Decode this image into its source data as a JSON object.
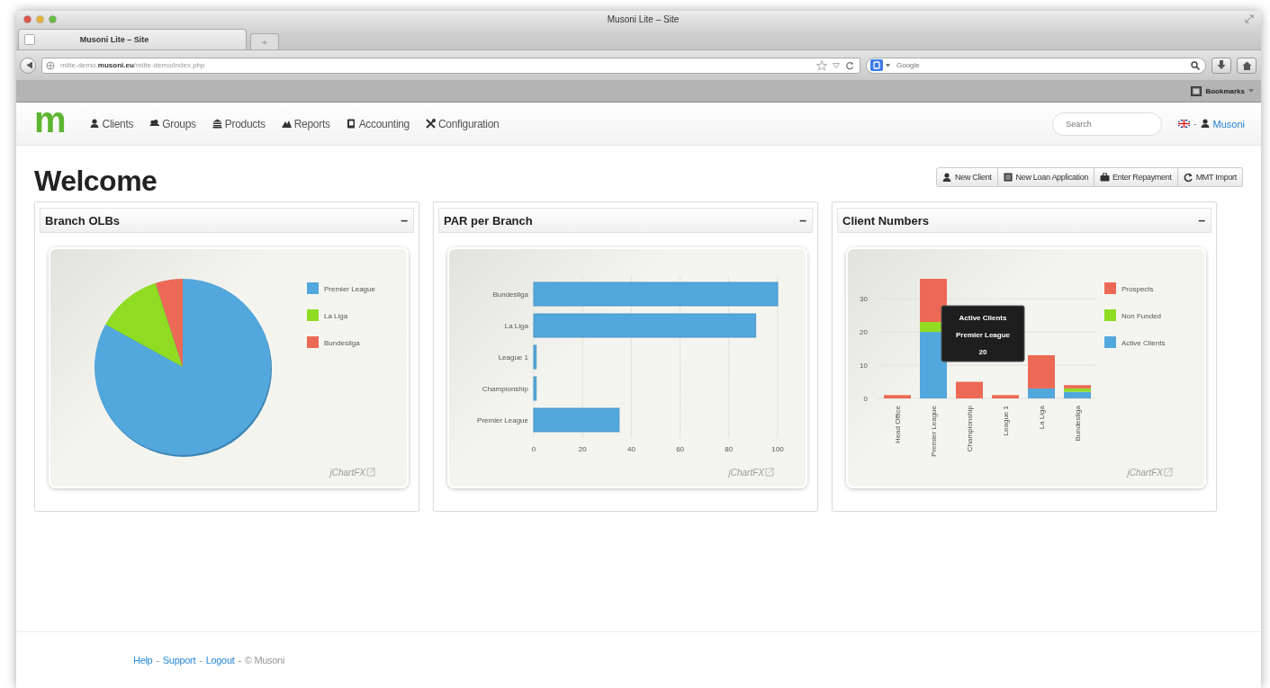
{
  "window": {
    "title": "Musoni Lite – Site"
  },
  "tabs": [
    {
      "label": "Musoni Lite – Site",
      "selected": true
    }
  ],
  "new_tab": "+",
  "address_bar": {
    "url": "mlite-demo.**musoni.eu**/mlite-demo/index.php"
  },
  "search_bar": {
    "placeholder": "Google"
  },
  "bookmarks_bar": {
    "label": "Bookmarks"
  },
  "navbar": {
    "logo": "m",
    "items": [
      {
        "label": "Clients"
      },
      {
        "label": "Groups"
      },
      {
        "label": "Products"
      },
      {
        "label": "Reports"
      },
      {
        "label": "Accounting"
      },
      {
        "label": "Configuration"
      }
    ],
    "search": {
      "placeholder": "Search"
    },
    "separator": "-",
    "user": "Musoni"
  },
  "page_title": "Welcome",
  "actions": [
    {
      "label": "New Client"
    },
    {
      "label": "New Loan Application"
    },
    {
      "label": "Enter Repayment"
    },
    {
      "label": "MMT Import"
    }
  ],
  "panels": [
    {
      "title": "Branch OLBs",
      "collapse": "–",
      "kind": "pie",
      "credit": "jChartFX",
      "legend": [
        {
          "label": "Premier League",
          "color": "#52a7dc"
        },
        {
          "label": "La Liga",
          "color": "#8fdc22"
        },
        {
          "label": "Bundesliga",
          "color": "#ec6a55"
        }
      ]
    },
    {
      "title": "PAR per Branch",
      "collapse": "–",
      "kind": "chart",
      "credit": "jChartFX",
      "chart_data": {
        "type": "bar",
        "orientation": "horizontal",
        "grid": true,
        "categories": [
          "Bundesliga",
          "La Liga",
          "League 1",
          "Championship",
          "Premier League"
        ],
        "series": [
          {
            "color": "#52a7dc",
            "values": [
              100,
              91,
              1,
              1,
              35
            ]
          }
        ],
        "xlim": [
          0,
          100
        ],
        "xticks": [
          0,
          20,
          40,
          60,
          80,
          100
        ]
      }
    },
    {
      "title": "Client Numbers",
      "collapse": "–",
      "kind": "chart",
      "credit": "jChartFX",
      "chart_data": {
        "type": "bar",
        "orientation": "vertical",
        "stacked": true,
        "grid": true,
        "legend": true,
        "categories": [
          "Head Office",
          "Premier League",
          "Championship",
          "League 1",
          "La Liga",
          "Bundesliga"
        ],
        "series": [
          {
            "name": "Prospects",
            "color": "#ec6a55",
            "values": [
              1,
              13,
              5,
              1,
              10,
              1
            ]
          },
          {
            "name": "Non Funded",
            "color": "#8fdc22",
            "values": [
              0,
              3,
              0,
              0,
              0,
              1
            ]
          },
          {
            "name": "Active Clients",
            "color": "#52a7dc",
            "values": [
              0,
              20,
              0,
              0,
              3,
              2
            ]
          }
        ],
        "ylim": [
          0,
          36
        ],
        "yticks": [
          0,
          10,
          20,
          30
        ]
      },
      "tooltip": {
        "series": "Active Clients",
        "category": "Premier League",
        "value": "20"
      }
    }
  ],
  "footer": {
    "links": [
      {
        "label": "Help"
      },
      {
        "label": "Support"
      },
      {
        "label": "Logout"
      }
    ],
    "separator": "-",
    "copyright": "© Musoni"
  }
}
